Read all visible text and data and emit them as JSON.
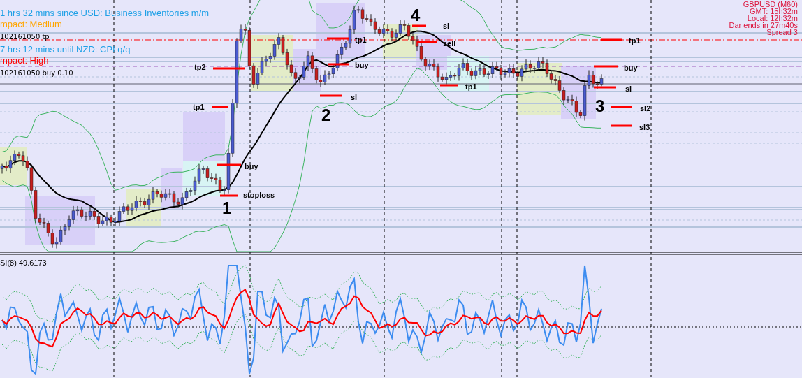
{
  "news": [
    {
      "text": "1 hrs 32 mins since USD: Business Inventories m/m",
      "kind": "event"
    },
    {
      "text": "mpact: Medium",
      "kind": "impact",
      "color": "#ffa500"
    },
    {
      "text": "102161050 tp",
      "kind": "order"
    },
    {
      "text": "7 hrs 12 mins until NZD: CPI q/q",
      "kind": "event"
    },
    {
      "text": "mpact: High",
      "kind": "impact",
      "color": "#ff0000"
    },
    {
      "text": "102161050 buy 0.10",
      "kind": "order"
    }
  ],
  "symbol_info": [
    "GBPUSD (M60)",
    "GMT: 15h32m",
    "Local: 12h32m",
    "Dar ends in 27m40s",
    "Spread 3"
  ],
  "annotations": [
    {
      "text": "tp2",
      "kind": "level"
    },
    {
      "text": "tp1",
      "kind": "level"
    },
    {
      "text": "buy",
      "kind": "level"
    },
    {
      "text": "stoploss",
      "kind": "level"
    },
    {
      "text": "1",
      "kind": "marker"
    },
    {
      "text": "2",
      "kind": "marker"
    },
    {
      "text": "sl",
      "kind": "level"
    },
    {
      "text": "buy",
      "kind": "level"
    },
    {
      "text": "tp1",
      "kind": "level"
    },
    {
      "text": "4",
      "kind": "marker"
    },
    {
      "text": "sl",
      "kind": "level"
    },
    {
      "text": "sell",
      "kind": "level"
    },
    {
      "text": "tp1",
      "kind": "level"
    },
    {
      "text": "tp1",
      "kind": "level"
    },
    {
      "text": "buy",
      "kind": "level"
    },
    {
      "text": "sl",
      "kind": "level"
    },
    {
      "text": "3",
      "kind": "marker"
    },
    {
      "text": "sl2",
      "kind": "level"
    },
    {
      "text": "sl3",
      "kind": "level"
    }
  ],
  "indicator": {
    "label": "SI(8) 49.6173"
  }
}
